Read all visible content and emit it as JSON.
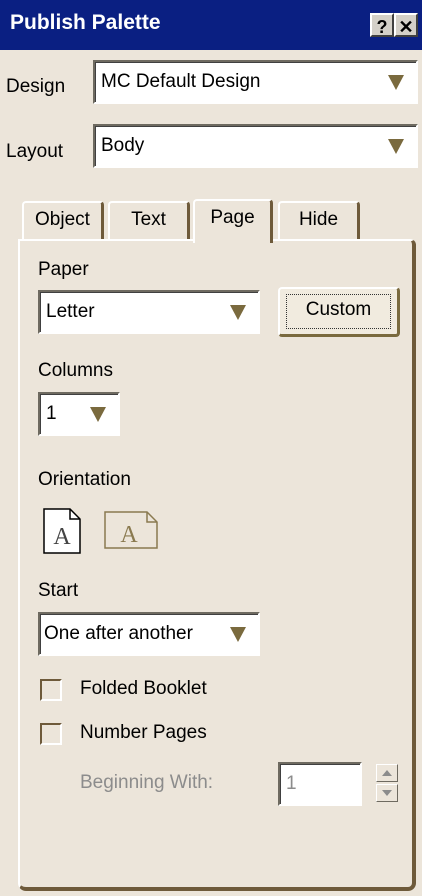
{
  "window": {
    "title": "Publish Palette",
    "help_label": "?",
    "close_label": "✕"
  },
  "design": {
    "label": "Design",
    "value": "MC Default Design"
  },
  "layout": {
    "label": "Layout",
    "value": "Body"
  },
  "tabs": [
    {
      "label": "Object",
      "active": false
    },
    {
      "label": "Text",
      "active": false
    },
    {
      "label": "Page",
      "active": true
    },
    {
      "label": "Hide",
      "active": false
    }
  ],
  "page": {
    "paper_label": "Paper",
    "paper_value": "Letter",
    "custom_button": "Custom",
    "columns_label": "Columns",
    "columns_value": "1",
    "orientation_label": "Orientation",
    "portrait_glyph": "A",
    "landscape_glyph": "A",
    "start_label": "Start",
    "start_value": "One after another",
    "folded_booklet_label": "Folded Booklet",
    "number_pages_label": "Number Pages",
    "beginning_with_label": "Beginning With:",
    "beginning_with_value": "1"
  },
  "colors": {
    "titlebar": "#0A1F82",
    "panel": "#ECE5DA",
    "accent": "#7A6A3E"
  },
  "icons": [
    "help-icon",
    "close-icon",
    "dropdown-arrow-icon",
    "portrait-icon",
    "landscape-icon",
    "spin-up-icon",
    "spin-down-icon"
  ]
}
